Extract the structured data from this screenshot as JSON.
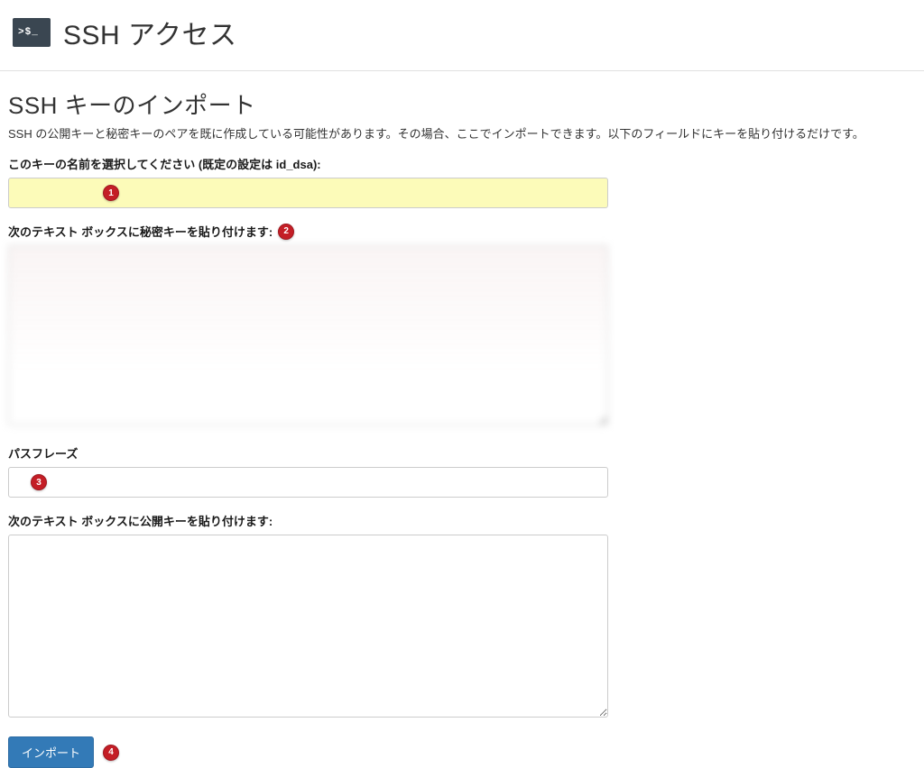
{
  "header": {
    "icon_glyph": ">$_",
    "title": "SSH アクセス"
  },
  "section": {
    "title": "SSH キーのインポート",
    "description": "SSH の公開キーと秘密キーのペアを既に作成している可能性があります。その場合、ここでインポートできます。以下のフィールドにキーを貼り付けるだけです。"
  },
  "fields": {
    "key_name": {
      "label": "このキーの名前を選択してください (既定の設定は id_dsa):",
      "value": ""
    },
    "private_key": {
      "label": "次のテキスト ボックスに秘密キーを貼り付けます:",
      "value": ""
    },
    "passphrase": {
      "label": "パスフレーズ",
      "value": ""
    },
    "public_key": {
      "label": "次のテキスト ボックスに公開キーを貼り付けます:",
      "value": ""
    }
  },
  "buttons": {
    "import": "インポート"
  },
  "annotations": {
    "badge1": "1",
    "badge2": "2",
    "badge3": "3",
    "badge4": "4"
  }
}
